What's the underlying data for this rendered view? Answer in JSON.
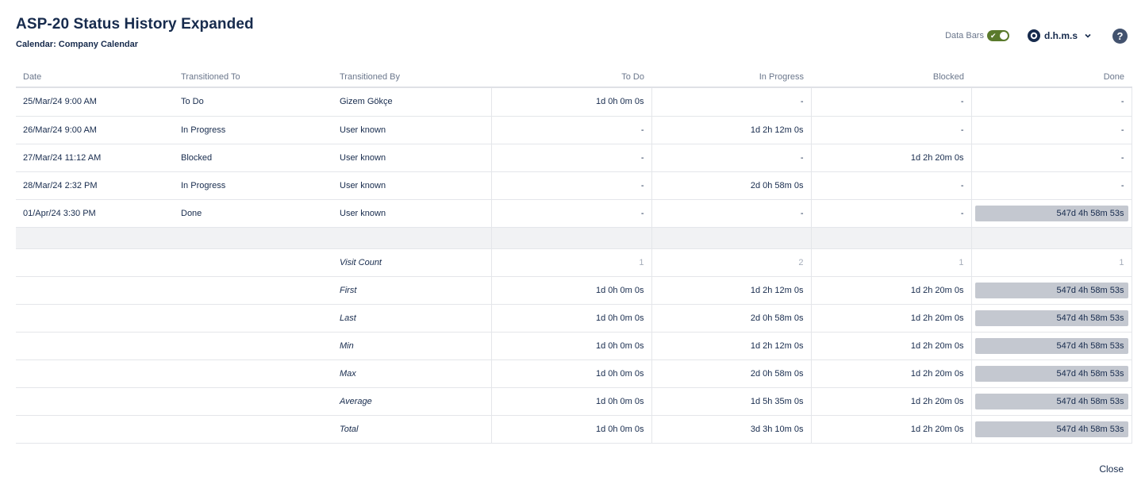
{
  "header": {
    "title": "ASP-20 Status History Expanded",
    "calendar": "Calendar: Company Calendar"
  },
  "controls": {
    "databars_label": "Data Bars",
    "databars_on": true,
    "format_value": "d.h.m.s",
    "help_label": "?"
  },
  "table": {
    "columns": [
      "Date",
      "Transitioned To",
      "Transitioned By",
      "To Do",
      "In Progress",
      "Blocked",
      "Done"
    ],
    "rows": [
      {
        "date": "25/Mar/24 9:00 AM",
        "to": "To Do",
        "by": "Gizem Gökçe",
        "todo": "1d 0h 0m 0s",
        "inprogress": "-",
        "blocked": "-",
        "done": "-"
      },
      {
        "date": "26/Mar/24 9:00 AM",
        "to": "In Progress",
        "by": "User known",
        "todo": "-",
        "inprogress": "1d 2h 12m 0s",
        "blocked": "-",
        "done": "-"
      },
      {
        "date": "27/Mar/24 11:12 AM",
        "to": "Blocked",
        "by": "User known",
        "todo": "-",
        "inprogress": "-",
        "blocked": "1d 2h 20m 0s",
        "done": "-"
      },
      {
        "date": "28/Mar/24 2:32 PM",
        "to": "In Progress",
        "by": "User known",
        "todo": "-",
        "inprogress": "2d 0h 58m 0s",
        "blocked": "-",
        "done": "-"
      },
      {
        "date": "01/Apr/24 3:30 PM",
        "to": "Done",
        "by": "User known",
        "todo": "-",
        "inprogress": "-",
        "blocked": "-",
        "done": "547d 4h 58m 53s"
      }
    ],
    "stats": [
      {
        "label": "Visit Count",
        "todo": "1",
        "inprogress": "2",
        "blocked": "1",
        "done": "1"
      },
      {
        "label": "First",
        "todo": "1d 0h 0m 0s",
        "inprogress": "1d 2h 12m 0s",
        "blocked": "1d 2h 20m 0s",
        "done": "547d 4h 58m 53s"
      },
      {
        "label": "Last",
        "todo": "1d 0h 0m 0s",
        "inprogress": "2d 0h 58m 0s",
        "blocked": "1d 2h 20m 0s",
        "done": "547d 4h 58m 53s"
      },
      {
        "label": "Min",
        "todo": "1d 0h 0m 0s",
        "inprogress": "1d 2h 12m 0s",
        "blocked": "1d 2h 20m 0s",
        "done": "547d 4h 58m 53s"
      },
      {
        "label": "Max",
        "todo": "1d 0h 0m 0s",
        "inprogress": "2d 0h 58m 0s",
        "blocked": "1d 2h 20m 0s",
        "done": "547d 4h 58m 53s"
      },
      {
        "label": "Average",
        "todo": "1d 0h 0m 0s",
        "inprogress": "1d 5h 35m 0s",
        "blocked": "1d 2h 20m 0s",
        "done": "547d 4h 58m 53s"
      },
      {
        "label": "Total",
        "todo": "1d 0h 0m 0s",
        "inprogress": "3d 3h 10m 0s",
        "blocked": "1d 2h 20m 0s",
        "done": "547d 4h 58m 53s"
      }
    ]
  },
  "footer": {
    "close_label": "Close"
  }
}
